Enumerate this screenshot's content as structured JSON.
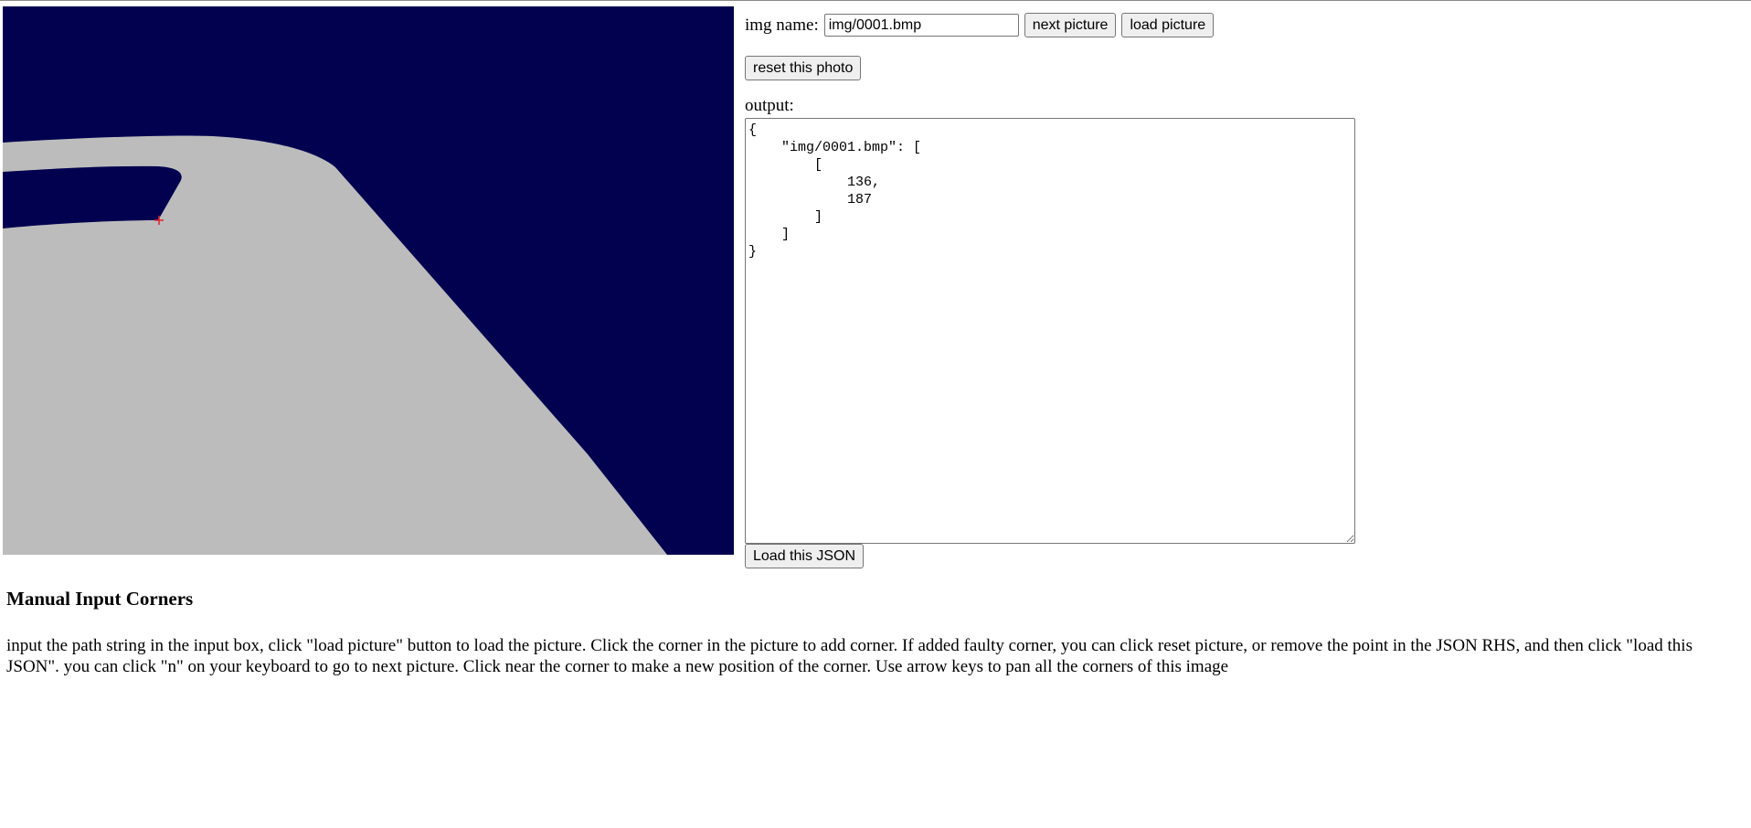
{
  "img_name_label": "img name:",
  "img_name_value": "img/0001.bmp",
  "buttons": {
    "next": "next picture",
    "load": "load picture",
    "reset": "reset this photo",
    "load_json": "Load this JSON"
  },
  "output_label": "output:",
  "output_text": "{\n    \"img/0001.bmp\": [\n        [\n            136,\n            187\n        ]\n    ]\n}",
  "heading": "Manual Input Corners",
  "description": "input the path string in the input box, click \"load picture\" button to load the picture. Click the corner in the picture to add corner. If added faulty corner, you can click reset picture, or remove the point in the JSON RHS, and then click \"load this JSON\". you can click \"n\" on your keyboard to go to next picture. Click near the corner to make a new position of the corner. Use arrow keys to pan all the corners of this image",
  "colors": {
    "canvas_background": "#020150",
    "shape_fill": "#bcbcbc",
    "corner_marker": "#e0202a"
  }
}
